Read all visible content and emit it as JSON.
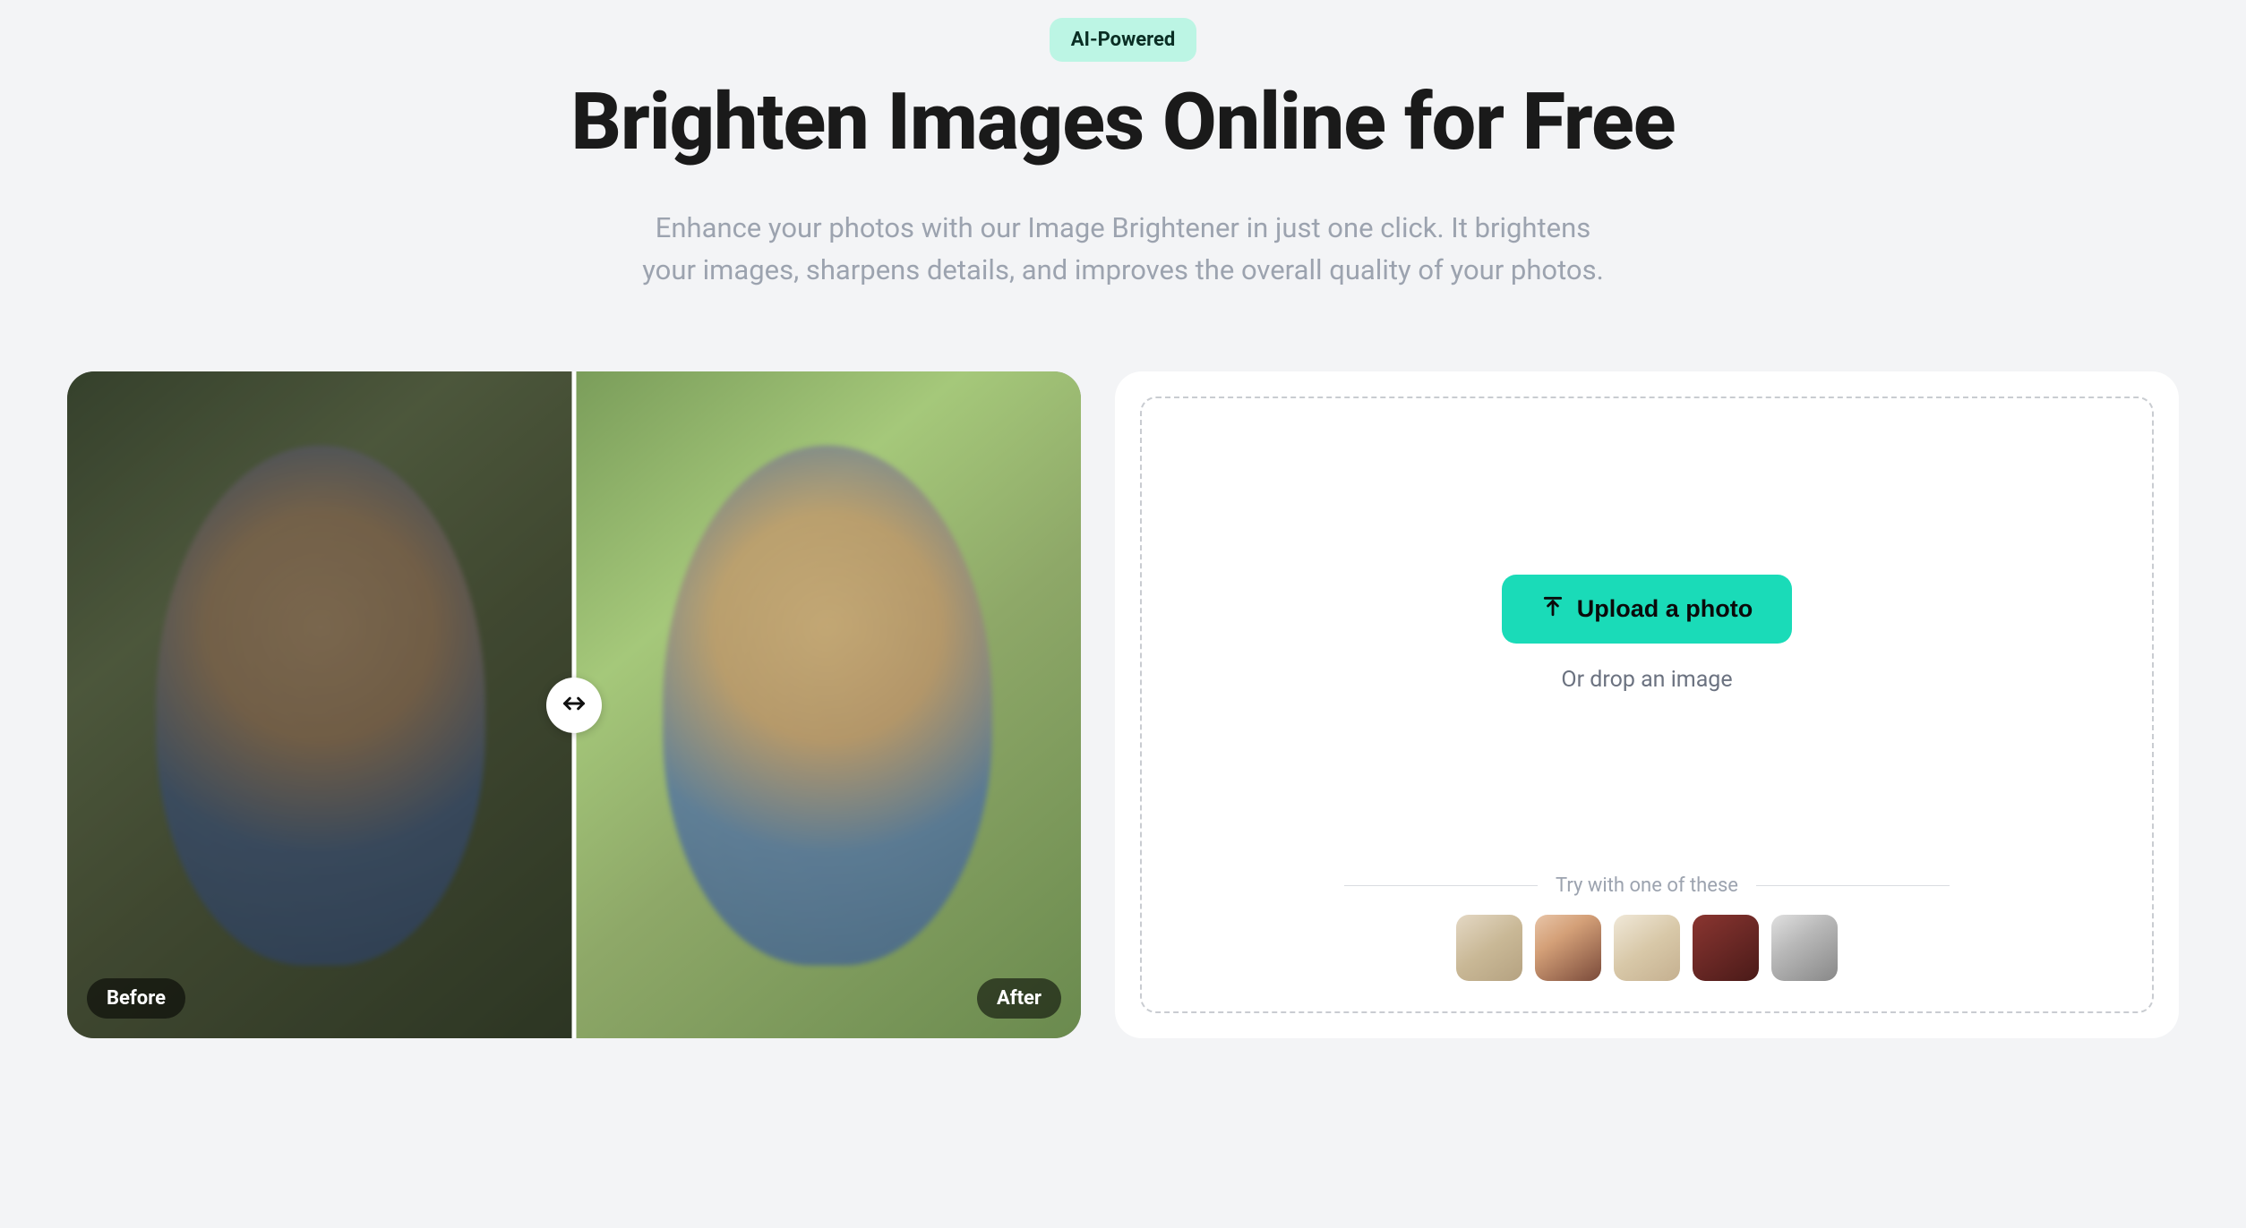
{
  "header": {
    "badge": "AI-Powered",
    "title": "Brighten Images Online for Free",
    "subtitle": "Enhance your photos with our Image Brightener in just one click. It brightens your images, sharpens details, and improves the overall quality of your photos."
  },
  "comparison": {
    "before_label": "Before",
    "after_label": "After"
  },
  "upload": {
    "button_label": "Upload a photo",
    "drop_text": "Or drop an image",
    "samples_label": "Try with one of these"
  },
  "colors": {
    "accent": "#1adbb8",
    "badge_bg": "#bcf5e4"
  }
}
